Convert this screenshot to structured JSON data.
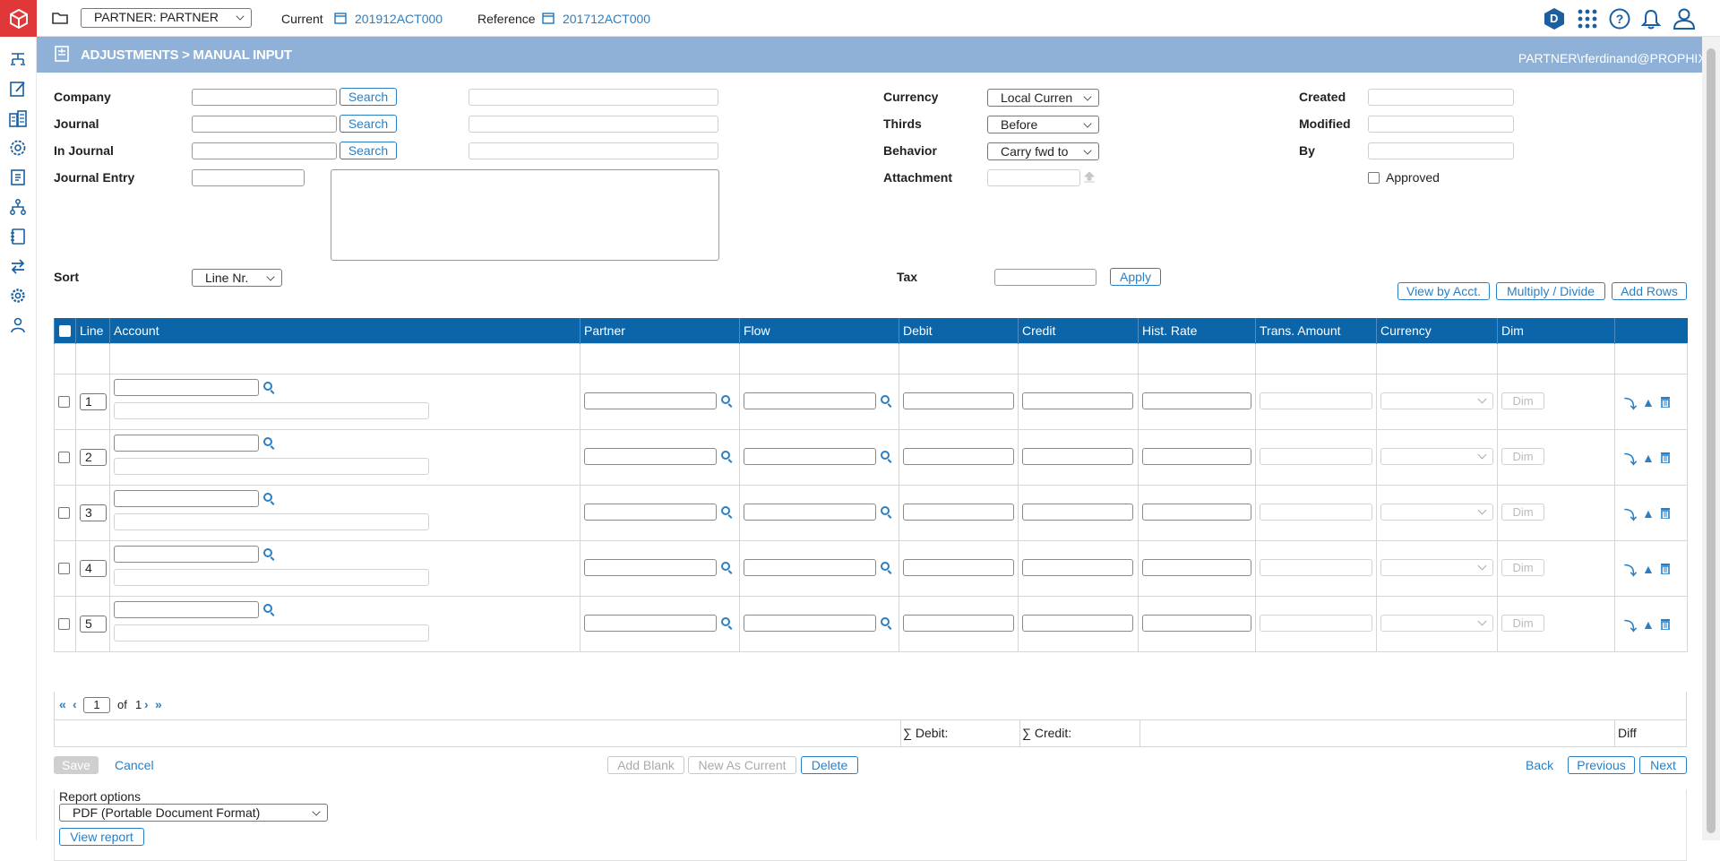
{
  "topbar": {
    "entity_select": "PARTNER: PARTNER",
    "current_label": "Current",
    "current_value": "201912ACT000",
    "reference_label": "Reference",
    "reference_value": "201712ACT000",
    "avatar_letter": "D"
  },
  "banner": {
    "title": "ADJUSTMENTS > MANUAL INPUT",
    "user": "PARTNER\\rferdinand@PROPHIX.com"
  },
  "form": {
    "company_label": "Company",
    "journal_label": "Journal",
    "in_journal_label": "In Journal",
    "journal_entry_label": "Journal Entry",
    "search_label": "Search",
    "sort_label": "Sort",
    "sort_value": "Line Nr.",
    "currency_label": "Currency",
    "currency_value": "Local Curren",
    "thirds_label": "Thirds",
    "thirds_value": "Before",
    "behavior_label": "Behavior",
    "behavior_value": "Carry fwd to",
    "attachment_label": "Attachment",
    "tax_label": "Tax",
    "apply_label": "Apply",
    "created_label": "Created",
    "modified_label": "Modified",
    "by_label": "By",
    "approved_label": "Approved"
  },
  "actions": {
    "view_by_acct": "View by Acct.",
    "multiply_divide": "Multiply / Divide",
    "add_rows": "Add Rows"
  },
  "grid": {
    "headers": [
      "Line",
      "Account",
      "Partner",
      "Flow",
      "Debit",
      "Credit",
      "Hist. Rate",
      "Trans. Amount",
      "Currency",
      "Dim"
    ],
    "rows": [
      {
        "line": "1"
      },
      {
        "line": "2"
      },
      {
        "line": "3"
      },
      {
        "line": "4"
      },
      {
        "line": "5"
      }
    ],
    "dim_label": "Dim",
    "pager": {
      "page": "1",
      "of_label": "of",
      "total": "1"
    },
    "sum_debit": "∑ Debit:",
    "sum_credit": "∑ Credit:",
    "diff": "Diff"
  },
  "footer": {
    "save": "Save",
    "cancel": "Cancel",
    "add_blank": "Add Blank",
    "new_as_current": "New As Current",
    "delete": "Delete",
    "back": "Back",
    "previous": "Previous",
    "next": "Next"
  },
  "report": {
    "title": "Report options",
    "format": "PDF (Portable Document Format)",
    "view": "View report"
  },
  "colors": {
    "accent": "#2a7fc4",
    "header": "#0c65a8",
    "banner": "#8fb1d8",
    "logo": "#e03838"
  }
}
